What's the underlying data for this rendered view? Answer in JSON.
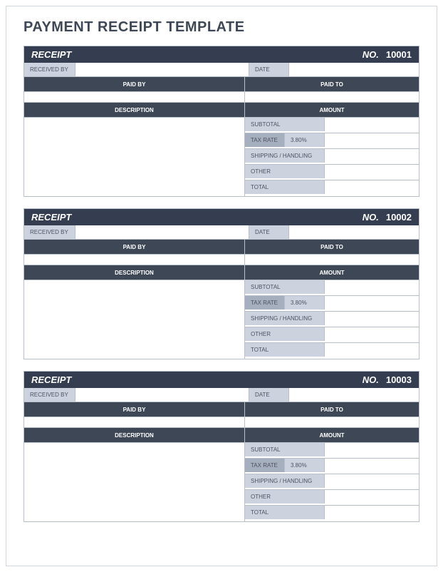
{
  "title": "PAYMENT RECEIPT TEMPLATE",
  "labels": {
    "receipt": "RECEIPT",
    "no": "NO.",
    "received_by": "RECEIVED BY",
    "date": "DATE",
    "paid_by": "PAID BY",
    "paid_to": "PAID TO",
    "description": "DESCRIPTION",
    "amount": "AMOUNT",
    "subtotal": "SUBTOTAL",
    "tax_rate": "TAX RATE",
    "shipping": "SHIPPING / HANDLING",
    "other": "OTHER",
    "total": "TOTAL"
  },
  "receipts": [
    {
      "number": "10001",
      "received_by": "",
      "date": "",
      "paid_by": "",
      "paid_to": "",
      "description": "",
      "subtotal": "",
      "tax_rate": "3.80%",
      "shipping": "",
      "other": "",
      "total": ""
    },
    {
      "number": "10002",
      "received_by": "",
      "date": "",
      "paid_by": "",
      "paid_to": "",
      "description": "",
      "subtotal": "",
      "tax_rate": "3.80%",
      "shipping": "",
      "other": "",
      "total": ""
    },
    {
      "number": "10003",
      "received_by": "",
      "date": "",
      "paid_by": "",
      "paid_to": "",
      "description": "",
      "subtotal": "",
      "tax_rate": "3.80%",
      "shipping": "",
      "other": "",
      "total": ""
    }
  ]
}
